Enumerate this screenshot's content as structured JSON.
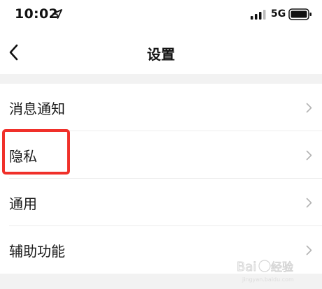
{
  "status_bar": {
    "time": "10:02",
    "network": "5G",
    "icons": [
      "location-arrow-icon",
      "signal-icon",
      "battery-icon"
    ]
  },
  "header": {
    "title": "设置",
    "back_icon": "chevron-left-icon"
  },
  "settings": {
    "items": [
      {
        "label": "消息通知"
      },
      {
        "label": "隐私"
      },
      {
        "label": "通用"
      },
      {
        "label": "辅助功能"
      }
    ]
  },
  "annotation": {
    "highlight_color": "#f0302a",
    "highlighted_item": "隐私"
  },
  "watermark": {
    "text": "Baidu 经验"
  }
}
